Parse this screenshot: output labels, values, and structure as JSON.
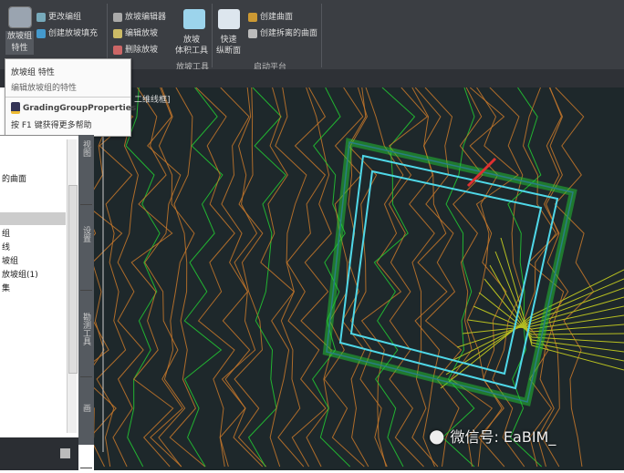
{
  "ribbon": {
    "grading_group_props": "放坡组\n特性",
    "change_group": "更改编组",
    "create_infill": "创建放坡填充",
    "grading_editor": "放坡编辑器",
    "edit_grading": "编辑放坡",
    "delete_grading": "删除放坡",
    "volume_tools": "放坡\n体积工具",
    "group_grading_tools": "放坡工具",
    "quick_profile": "快速\n纵断面",
    "create_surface": "创建曲面",
    "create_cropped_surface": "创建拆离的曲面",
    "group_launch_pad": "启动平台"
  },
  "tooltip": {
    "title": "放坡组 特性",
    "desc": "编辑放坡组的特性",
    "command": "GradingGroupProperties",
    "help": "按 F1 键获得更多帮助"
  },
  "viewport_label": "二维线框]",
  "panel": {
    "items": [
      "的曲面",
      "组",
      "线",
      "坡组",
      "放坡组(1)",
      "集"
    ]
  },
  "side_tabs": [
    "视图",
    "设置",
    "勘测工具",
    "画"
  ],
  "watermark": "微信号: EaBIM_",
  "colors": {
    "canvas": "#1e282b",
    "cyan": "#4fd8e8",
    "green": "#22cc33",
    "orange": "#c8782a"
  }
}
